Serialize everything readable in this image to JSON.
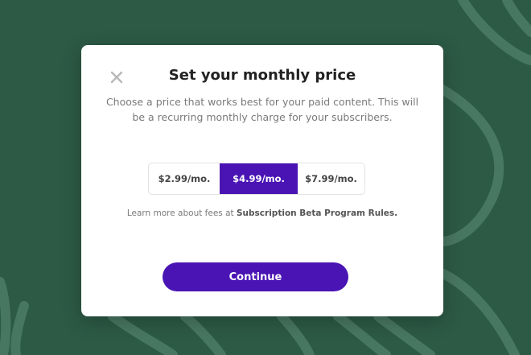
{
  "modal": {
    "title": "Set your monthly price",
    "subtitle": "Choose a price that works best for your paid content. This will be a recurring monthly charge for your subscribers.",
    "close_icon": "close-icon"
  },
  "prices": {
    "options": [
      "$2.99/mo.",
      "$4.99/mo.",
      "$7.99/mo."
    ],
    "selected": "$4.99/mo."
  },
  "fees": {
    "prefix": "Learn more about fees at ",
    "link": "Subscription Beta Program Rules."
  },
  "actions": {
    "continue_label": "Continue"
  },
  "colors": {
    "background": "#2c5a45",
    "accent": "#4a14b4"
  }
}
